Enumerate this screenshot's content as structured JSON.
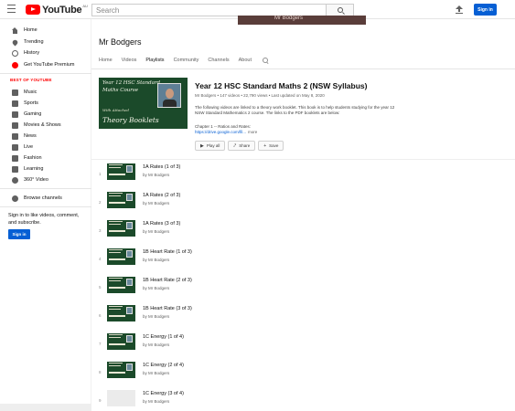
{
  "header": {
    "logo_text": "YouTube",
    "logo_region": "AU",
    "search_placeholder": "Search",
    "banner_text": "Mr Bodgers",
    "signin_label": "Sign in"
  },
  "sidebar": {
    "main_items": [
      {
        "label": "Home",
        "icon": "home-icon"
      },
      {
        "label": "Trending",
        "icon": "trending-icon"
      },
      {
        "label": "History",
        "icon": "history-icon"
      },
      {
        "label": "Get YouTube Premium",
        "icon": "youtube-premium-icon"
      }
    ],
    "best_heading": "BEST OF YOUTUBE",
    "best_items": [
      {
        "label": "Music",
        "icon": "music-icon"
      },
      {
        "label": "Sports",
        "icon": "sports-icon"
      },
      {
        "label": "Gaming",
        "icon": "gaming-icon"
      },
      {
        "label": "Movies & Shows",
        "icon": "movies-icon"
      },
      {
        "label": "News",
        "icon": "news-icon"
      },
      {
        "label": "Live",
        "icon": "live-icon"
      },
      {
        "label": "Fashion",
        "icon": "fashion-icon"
      },
      {
        "label": "Learning",
        "icon": "learning-icon"
      },
      {
        "label": "360° Video",
        "icon": "360-video-icon"
      }
    ],
    "browse_label": "Browse channels",
    "signin_prompt_line1": "Sign in to like videos, comment,",
    "signin_prompt_line2": "and subscribe.",
    "signin_label": "Sign in"
  },
  "channel": {
    "name": "Mr Bodgers",
    "tabs": [
      "Home",
      "Videos",
      "Playlists",
      "Community",
      "Channels",
      "About"
    ],
    "active_tab": "Playlists"
  },
  "playlist": {
    "thumb_line1": "Year 12 HSC Standard",
    "thumb_line2": "Maths Course",
    "thumb_line3": "With Attached",
    "thumb_line4": "Theory Booklets",
    "title": "Year 12 HSC Standard Maths 2 (NSW Syllabus)",
    "meta": "Mr Bodgers • 147 videos • 22,790 views • Last updated on May 8, 2020",
    "description": "The following videos are linked to a theory work booklet. This book is to help students studying for the year 12 NSW Standard Mathematics 2 course. The links to the PDF booklets are below:",
    "chapter": "Chapter 1 -- Ratios and Rates:",
    "link": "https://drive.google.com/fil...",
    "more": "more",
    "actions": {
      "play_all": "Play all",
      "share": "Share",
      "save": "Save"
    }
  },
  "videos": [
    {
      "index": "1",
      "title": "1A Rates (1 of 3)",
      "author": "by Mr Bodgers"
    },
    {
      "index": "2",
      "title": "1A Rates (2 of 3)",
      "author": "by Mr Bodgers"
    },
    {
      "index": "3",
      "title": "1A Rates (3 of 3)",
      "author": "by Mr Bodgers"
    },
    {
      "index": "4",
      "title": "1B Heart Rate (1 of 3)",
      "author": "by Mr Bodgers"
    },
    {
      "index": "5",
      "title": "1B Heart Rate (2 of 3)",
      "author": "by Mr Bodgers"
    },
    {
      "index": "6",
      "title": "1B Heart Rate (3 of 3)",
      "author": "by Mr Bodgers"
    },
    {
      "index": "7",
      "title": "1C Energy (1 of 4)",
      "author": "by Mr Bodgers"
    },
    {
      "index": "8",
      "title": "1C Energy (2 of 4)",
      "author": "by Mr Bodgers"
    },
    {
      "index": "9",
      "title": "1C Energy (3 of 4)",
      "author": "by Mr Bodgers"
    }
  ],
  "colors": {
    "brand_red": "#ff0000",
    "signin_blue": "#065fd4",
    "thumb_green": "#1b4a2a"
  }
}
